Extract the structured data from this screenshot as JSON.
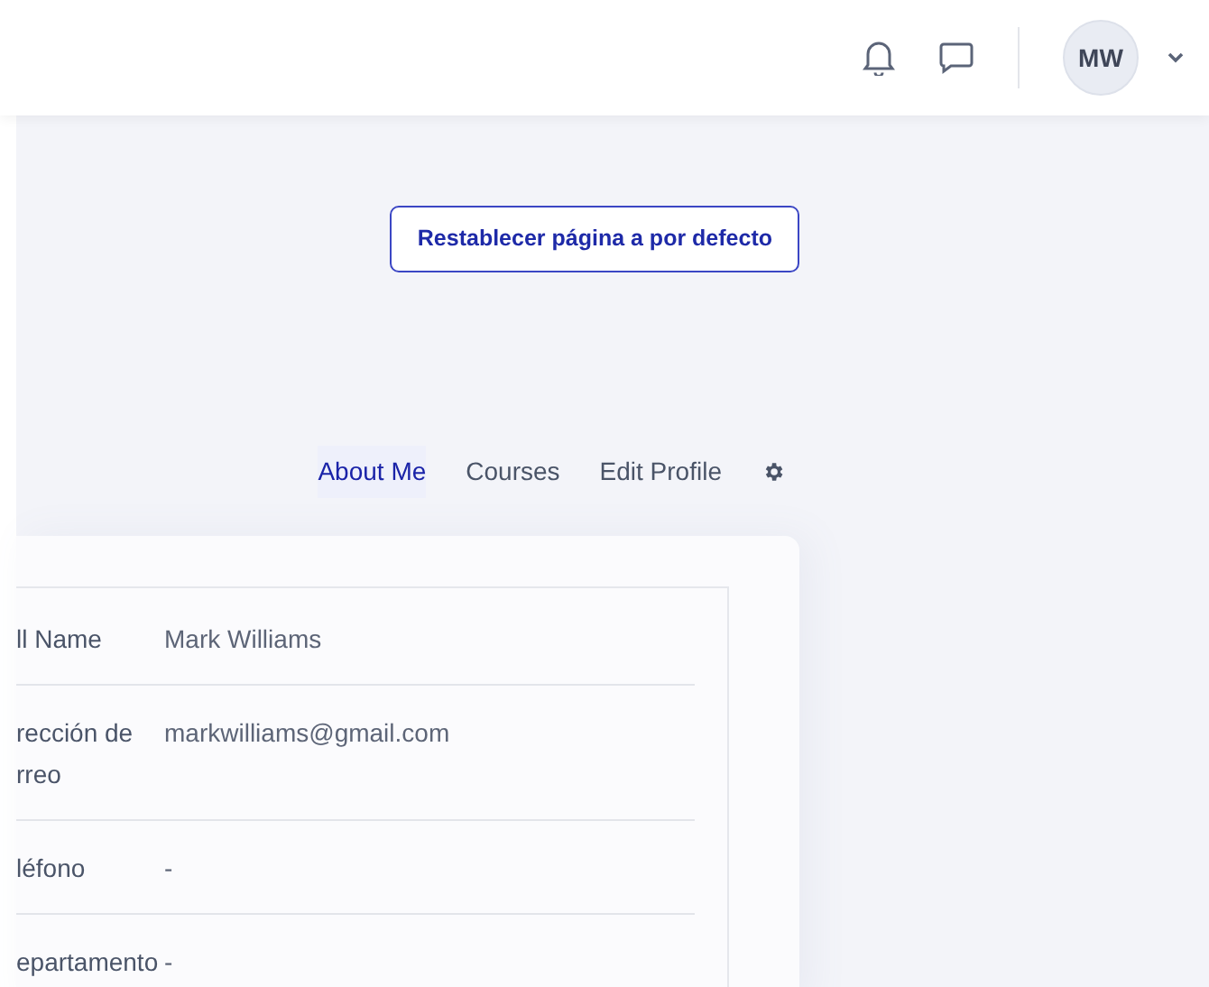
{
  "header": {
    "avatar_initials": "MW"
  },
  "reset_button": {
    "label": "Restablecer página a por defecto"
  },
  "tabs": [
    {
      "label": "About Me",
      "selected": true
    },
    {
      "label": "Courses",
      "selected": false
    },
    {
      "label": "Edit Profile",
      "selected": false
    }
  ],
  "details": [
    {
      "label_lines": [
        "ll Name"
      ],
      "value": "Mark Williams"
    },
    {
      "label_lines": [
        "rección de",
        "rreo"
      ],
      "value": "markwilliams@gmail.com"
    },
    {
      "label_lines": [
        "léfono"
      ],
      "value": "-"
    },
    {
      "label_lines": [
        "epartamento"
      ],
      "value": "-"
    }
  ]
}
